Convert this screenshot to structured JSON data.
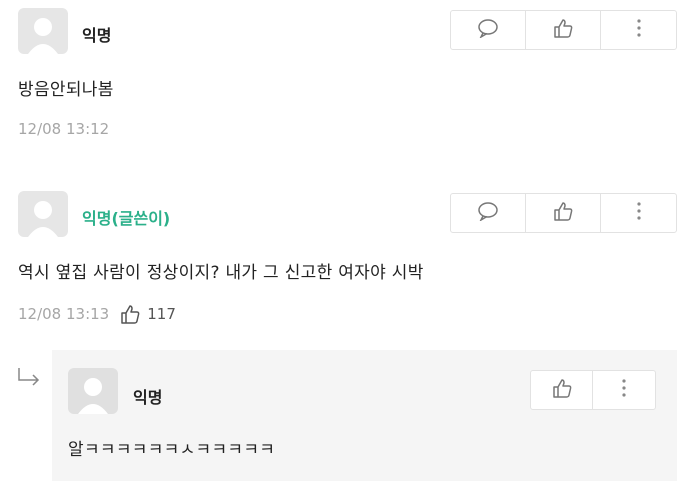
{
  "comments": [
    {
      "author": "익명",
      "content": "방음안되나봄",
      "timestamp": "12/08 13:12"
    },
    {
      "author": "익명(글쓴이)",
      "content": "역시 옆집 사람이 정상이지? 내가 그 신고한 여자야 시박",
      "timestamp": "12/08 13:13",
      "likes": "117"
    }
  ],
  "reply": {
    "author": "익명",
    "content": "알ㅋㅋㅋㅋㅋㅋㅅㅋㅋㅋㅋㅋ"
  },
  "icons": {
    "comment": "speech-bubble-icon",
    "like": "thumbs-up-icon",
    "more": "kebab-menu-icon",
    "reply_arrow": "reply-arrow-icon"
  },
  "colors": {
    "writer_label": "#2bb08a",
    "reply_background": "#f5f5f5"
  }
}
